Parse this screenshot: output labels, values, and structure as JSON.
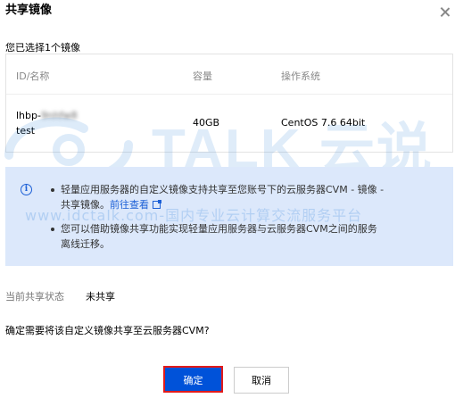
{
  "dialog": {
    "title": "共享镜像",
    "close_icon": "close-icon"
  },
  "selection": {
    "label": "您已选择1个镜像"
  },
  "table": {
    "columns": [
      "ID/名称",
      "容量",
      "操作系统"
    ],
    "rows": [
      {
        "id_prefix": "lhbp-",
        "id_obscured": "9nhfw8",
        "name": "test",
        "capacity": "40GB",
        "os": "CentOS 7.6 64bit"
      }
    ]
  },
  "notice": {
    "icon": "info-icon",
    "item1_text": "轻量应用服务器的自定义镜像支持共享至您账号下的云服务器CVM - 镜像 - 共享镜像。",
    "item1_line1": "轻量应用服务器的自定义镜像支持共享至您账号下的云服务器CVM - 镜像 -",
    "item1_line2": "共享镜像。",
    "item1_link": "前往查看",
    "item2_line1": "您可以借助镜像共享功能实现轻量应用服务器与云服务器CVM之间的服务",
    "item2_line2": "离线迁移。"
  },
  "status": {
    "label": "当前共享状态",
    "value": "未共享"
  },
  "confirm_question": "确定需要将该自定义镜像共享至云服务器CVM?",
  "buttons": {
    "confirm": "确定",
    "cancel": "取消"
  },
  "watermark": {
    "big": "TALK 云说",
    "small": "www.idctalk.com-国内专业云计算交流服务平台"
  },
  "colors": {
    "primary": "#0052d9",
    "notice_bg": "#dce8fb",
    "highlight_border": "#e21b1b"
  }
}
